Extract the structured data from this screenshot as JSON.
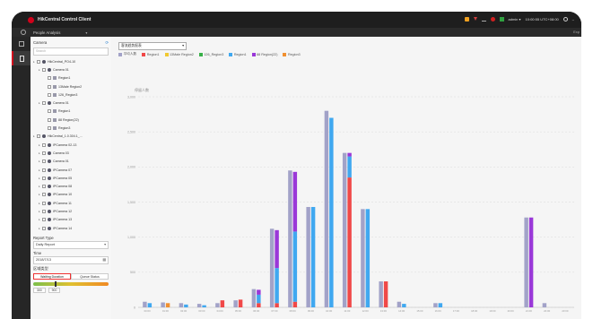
{
  "app": {
    "title": "HikCentral Control Client"
  },
  "titlebar": {
    "user": "admin ▾",
    "time": "10:00:55 UTC+08:00"
  },
  "menubar": {
    "module": "People Analysis",
    "right_label": "Exp"
  },
  "panel": {
    "header": "Camera",
    "search_placeholder": "Search",
    "tree": [
      {
        "level": 0,
        "label": "HikCentral_PO4-10",
        "type": "site"
      },
      {
        "level": 1,
        "label": "Camera 01",
        "type": "cam"
      },
      {
        "level": 2,
        "label": "Region1",
        "type": "region"
      },
      {
        "level": 2,
        "label": "13Male Region2",
        "type": "region"
      },
      {
        "level": 2,
        "label": "126_Region3",
        "type": "region"
      },
      {
        "level": 1,
        "label": "Camera 01",
        "type": "cam"
      },
      {
        "level": 2,
        "label": "Region1",
        "type": "region"
      },
      {
        "level": 2,
        "label": "88 Region(22)",
        "type": "region"
      },
      {
        "level": 2,
        "label": "Region3",
        "type": "region"
      },
      {
        "level": 0,
        "label": "HikCentral_1.0.304.1_...",
        "type": "site"
      },
      {
        "level": 1,
        "label": "IPCamera 02-13",
        "type": "cam"
      },
      {
        "level": 1,
        "label": "Camera 03",
        "type": "cam"
      },
      {
        "level": 1,
        "label": "Camera 01",
        "type": "cam"
      },
      {
        "level": 1,
        "label": "IPCamera 07",
        "type": "cam"
      },
      {
        "level": 1,
        "label": "IPCamera 05",
        "type": "cam"
      },
      {
        "level": 1,
        "label": "IPCamera 08",
        "type": "cam"
      },
      {
        "level": 1,
        "label": "IPCamera 10",
        "type": "cam"
      },
      {
        "level": 1,
        "label": "IPCamera 11",
        "type": "cam"
      },
      {
        "level": 1,
        "label": "IPCamera 12",
        "type": "cam"
      },
      {
        "level": 1,
        "label": "IPCamera 13",
        "type": "cam"
      },
      {
        "level": 1,
        "label": "IPCamera 14",
        "type": "cam"
      }
    ],
    "report_type_label": "Report Type",
    "report_type_value": "Daily Report",
    "time_label": "Time",
    "time_value": "2018/7/13",
    "dwell_label": "区域类型",
    "seg_options": [
      "Waiting Duration",
      "Queue Status"
    ],
    "range_from": "300",
    "range_to": "900"
  },
  "main": {
    "dropdown_value": "客流趋势报表"
  },
  "colors": {
    "lavender": "#a2a2c8",
    "red": "#f04848",
    "yellow": "#f0c830",
    "green": "#38b048",
    "blue": "#40a8f0",
    "purple": "#9a38d8",
    "orange": "#f09030"
  },
  "chart_data": {
    "type": "bar",
    "ylabel": "停留人数",
    "ylim": [
      0,
      3000
    ],
    "yticks": [
      0,
      500,
      1000,
      1500,
      2000,
      2500,
      3000
    ],
    "legend": [
      {
        "name": "平均人数",
        "color": "#a2a2c8"
      },
      {
        "name": "Region1",
        "color": "#f04848"
      },
      {
        "name": "13Male Region2",
        "color": "#f0c830"
      },
      {
        "name": "126_Region3",
        "color": "#38b048"
      },
      {
        "name": "Region1",
        "color": "#40a8f0"
      },
      {
        "name": "88 Region(22)",
        "color": "#9a38d8"
      },
      {
        "name": "Region3",
        "color": "#f09030"
      }
    ],
    "categories": [
      "00:00",
      "01:00",
      "02:00",
      "03:00",
      "04:00",
      "05:00",
      "06:00",
      "07:00",
      "08:00",
      "09:00",
      "10:00",
      "11:00",
      "12:00",
      "13:00",
      "14:00",
      "15:00",
      "16:00",
      "17:00",
      "18:00",
      "19:00",
      "20:00",
      "21:00",
      "22:00",
      "23:00"
    ],
    "bars": [
      [
        {
          "c": "#a2a2c8",
          "v": 80
        },
        {
          "c": "#40a8f0",
          "v": 60
        }
      ],
      [
        {
          "c": "#a2a2c8",
          "v": 70
        },
        {
          "c": "#f09030",
          "v": 60
        }
      ],
      [
        {
          "c": "#a2a2c8",
          "v": 60
        },
        {
          "c": "#40a8f0",
          "v": 40
        }
      ],
      [
        {
          "c": "#a2a2c8",
          "v": 50
        },
        {
          "c": "#40a8f0",
          "v": 30
        }
      ],
      [
        {
          "c": "#a2a2c8",
          "v": 60
        },
        {
          "c": "#f04848",
          "v": 100
        }
      ],
      [
        {
          "c": "#a2a2c8",
          "v": 100
        },
        {
          "c": "#f04848",
          "v": 110
        }
      ],
      [
        {
          "c": "#a2a2c8",
          "v": 260
        },
        {
          "c": "#40a8f0",
          "v": 0,
          "stack": [
            {
              "c": "#f04848",
              "v": 60
            },
            {
              "c": "#40a8f0",
              "v": 120
            },
            {
              "c": "#9a38d8",
              "v": 70
            }
          ]
        }
      ],
      [
        {
          "c": "#a2a2c8",
          "v": 1120
        },
        {
          "c": "#f04848",
          "v": 60,
          "stack": [
            {
              "c": "#f04848",
              "v": 60
            },
            {
              "c": "#40a8f0",
              "v": 500
            },
            {
              "c": "#9a38d8",
              "v": 540
            }
          ]
        }
      ],
      [
        {
          "c": "#a2a2c8",
          "v": 1950
        },
        {
          "c": "#f04848",
          "v": 80,
          "stack": [
            {
              "c": "#f04848",
              "v": 80
            },
            {
              "c": "#40a8f0",
              "v": 1000
            },
            {
              "c": "#9a38d8",
              "v": 850
            }
          ]
        }
      ],
      [
        {
          "c": "#a2a2c8",
          "v": 1430
        },
        {
          "c": "#40a8f0",
          "v": 1430
        }
      ],
      [
        {
          "c": "#a2a2c8",
          "v": 2800
        },
        {
          "c": "#40a8f0",
          "v": 2700
        }
      ],
      [
        {
          "c": "#a2a2c8",
          "v": 2200
        },
        {
          "c": "#f04848",
          "v": 1850,
          "stack": [
            {
              "c": "#f04848",
              "v": 1850
            },
            {
              "c": "#40a8f0",
              "v": 300
            },
            {
              "c": "#9a38d8",
              "v": 50
            }
          ]
        }
      ],
      [
        {
          "c": "#a2a2c8",
          "v": 1400
        },
        {
          "c": "#40a8f0",
          "v": 1400
        }
      ],
      [
        {
          "c": "#a2a2c8",
          "v": 370
        },
        {
          "c": "#f04848",
          "v": 370
        }
      ],
      [
        {
          "c": "#a2a2c8",
          "v": 80
        },
        {
          "c": "#40a8f0",
          "v": 50
        }
      ],
      [
        {
          "c": "#a2a2c8",
          "v": 0
        },
        {
          "c": "#40a8f0",
          "v": 0
        }
      ],
      [
        {
          "c": "#a2a2c8",
          "v": 60
        },
        {
          "c": "#40a8f0",
          "v": 60
        }
      ],
      [
        {
          "c": "#a2a2c8",
          "v": 0
        },
        {
          "c": "#40a8f0",
          "v": 0
        }
      ],
      [
        {
          "c": "#a2a2c8",
          "v": 0
        },
        {
          "c": "#40a8f0",
          "v": 0
        }
      ],
      [
        {
          "c": "#a2a2c8",
          "v": 0
        },
        {
          "c": "#40a8f0",
          "v": 0
        }
      ],
      [
        {
          "c": "#a2a2c8",
          "v": 0
        },
        {
          "c": "#40a8f0",
          "v": 0
        }
      ],
      [
        {
          "c": "#a2a2c8",
          "v": 1280
        },
        {
          "c": "#9a38d8",
          "v": 1280
        }
      ],
      [
        {
          "c": "#a2a2c8",
          "v": 60
        },
        {
          "c": "#40a8f0",
          "v": 0
        }
      ],
      [
        {
          "c": "#a2a2c8",
          "v": 0
        },
        {
          "c": "#40a8f0",
          "v": 0
        }
      ]
    ]
  }
}
